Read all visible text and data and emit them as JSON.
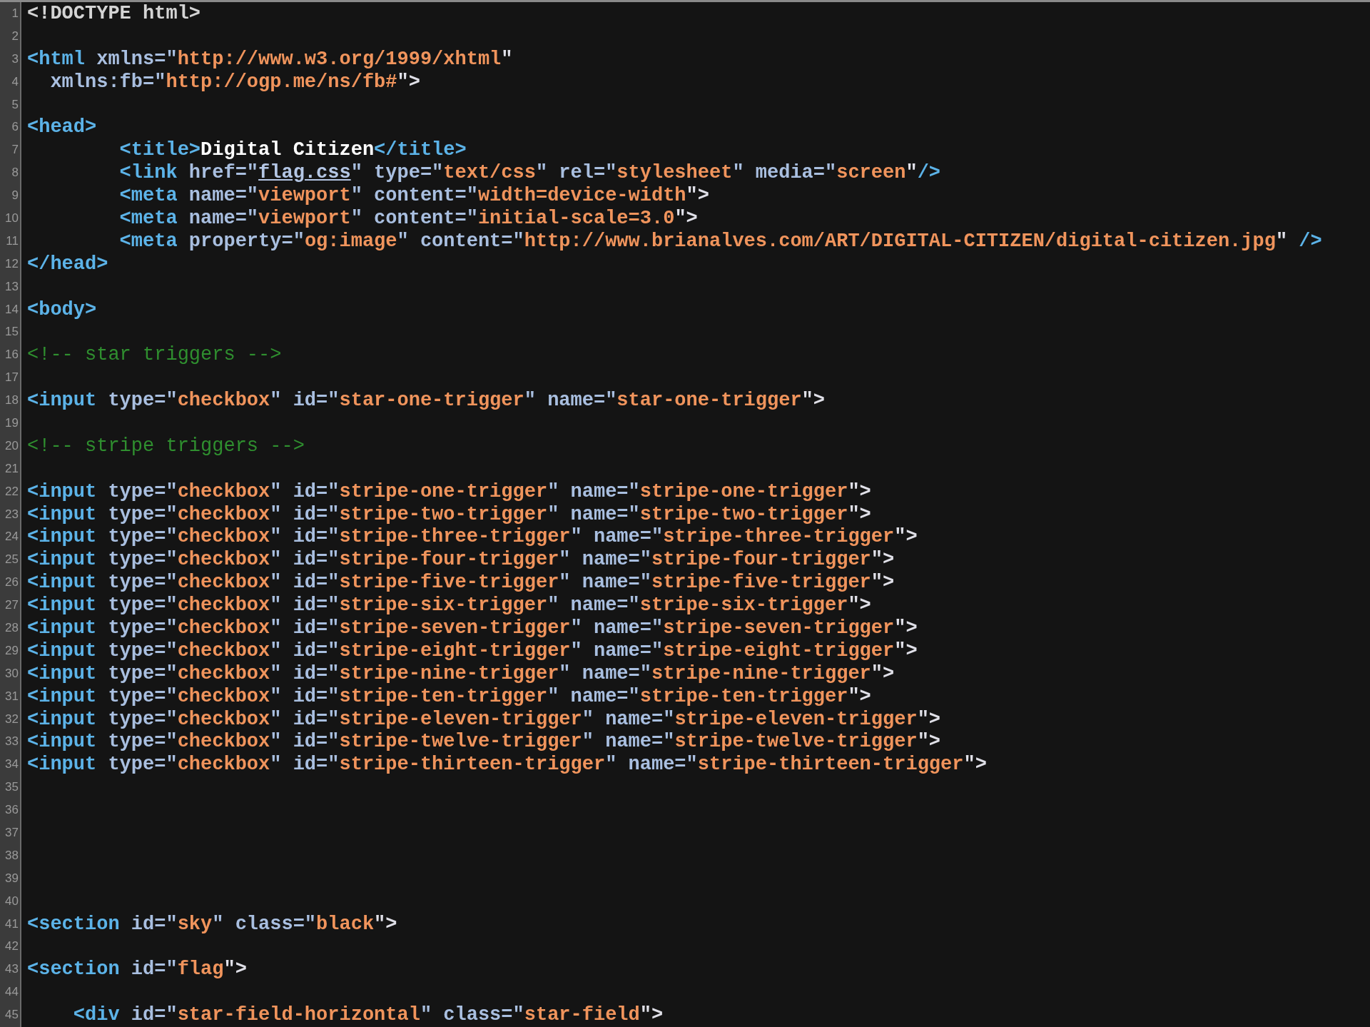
{
  "editor": {
    "lines": [
      {
        "number": "1",
        "tokens": [
          {
            "kind": "doctype",
            "text": "<!DOCTYPE html>"
          }
        ]
      },
      {
        "number": "2"
      },
      {
        "number": "3",
        "tokens": [
          {
            "kind": "tag",
            "text": "<html"
          },
          {
            "kind": "attr",
            "text": " xmlns=\""
          },
          {
            "kind": "string",
            "text": "http://www.w3.org/1999/xhtml"
          },
          {
            "kind": "punct",
            "text": "\""
          }
        ]
      },
      {
        "number": "4",
        "tokens": [
          {
            "kind": "attr",
            "text": "  xmlns:fb=\""
          },
          {
            "kind": "string",
            "text": "http://ogp.me/ns/fb#"
          },
          {
            "kind": "punct",
            "text": "\">"
          }
        ]
      },
      {
        "number": "5"
      },
      {
        "number": "6",
        "tokens": [
          {
            "kind": "tag",
            "text": "<head>"
          }
        ]
      },
      {
        "number": "7",
        "tokens": [
          {
            "kind": "tag",
            "text": "        <title>"
          },
          {
            "kind": "text",
            "text": "Digital Citizen"
          },
          {
            "kind": "tag",
            "text": "</title>"
          }
        ]
      },
      {
        "number": "8",
        "tokens": [
          {
            "kind": "tag",
            "text": "        <link"
          },
          {
            "kind": "attr",
            "text": " href=\""
          },
          {
            "kind": "link",
            "text": "flag.css"
          },
          {
            "kind": "attr",
            "text": "\" type=\""
          },
          {
            "kind": "string",
            "text": "text/css"
          },
          {
            "kind": "attr",
            "text": "\" rel=\""
          },
          {
            "kind": "string",
            "text": "stylesheet"
          },
          {
            "kind": "attr",
            "text": "\" media=\""
          },
          {
            "kind": "string",
            "text": "screen"
          },
          {
            "kind": "punct",
            "text": "\""
          },
          {
            "kind": "tag",
            "text": "/>"
          }
        ]
      },
      {
        "number": "9",
        "tokens": [
          {
            "kind": "tag",
            "text": "        <meta"
          },
          {
            "kind": "attr",
            "text": " name=\""
          },
          {
            "kind": "string",
            "text": "viewport"
          },
          {
            "kind": "attr",
            "text": "\" content=\""
          },
          {
            "kind": "string",
            "text": "width=device-width"
          },
          {
            "kind": "punct",
            "text": "\">"
          }
        ]
      },
      {
        "number": "10",
        "tokens": [
          {
            "kind": "tag",
            "text": "        <meta"
          },
          {
            "kind": "attr",
            "text": " name=\""
          },
          {
            "kind": "string",
            "text": "viewport"
          },
          {
            "kind": "attr",
            "text": "\" content=\""
          },
          {
            "kind": "string",
            "text": "initial-scale=3.0"
          },
          {
            "kind": "punct",
            "text": "\">"
          }
        ]
      },
      {
        "number": "11",
        "tokens": [
          {
            "kind": "tag",
            "text": "        <meta"
          },
          {
            "kind": "attr",
            "text": " property=\""
          },
          {
            "kind": "string",
            "text": "og:image"
          },
          {
            "kind": "attr",
            "text": "\" content=\""
          },
          {
            "kind": "string",
            "text": "http://www.brianalves.com/ART/DIGITAL-CITIZEN/digital-citizen.jpg"
          },
          {
            "kind": "punct",
            "text": "\" "
          },
          {
            "kind": "tag",
            "text": "/>"
          }
        ]
      },
      {
        "number": "12",
        "tokens": [
          {
            "kind": "tag",
            "text": "</head>"
          }
        ]
      },
      {
        "number": "13"
      },
      {
        "number": "14",
        "tokens": [
          {
            "kind": "tag",
            "text": "<body>"
          }
        ]
      },
      {
        "number": "15"
      },
      {
        "number": "16",
        "tokens": [
          {
            "kind": "comment",
            "text": "<!-- star triggers -->"
          }
        ]
      },
      {
        "number": "17"
      },
      {
        "number": "18",
        "tokens": [
          {
            "kind": "tag",
            "text": "<input"
          },
          {
            "kind": "attr",
            "text": " type=\""
          },
          {
            "kind": "string",
            "text": "checkbox"
          },
          {
            "kind": "attr",
            "text": "\" id=\""
          },
          {
            "kind": "string",
            "text": "star-one-trigger"
          },
          {
            "kind": "attr",
            "text": "\" name=\""
          },
          {
            "kind": "string",
            "text": "star-one-trigger"
          },
          {
            "kind": "punct",
            "text": "\">"
          }
        ]
      },
      {
        "number": "19"
      },
      {
        "number": "20",
        "tokens": [
          {
            "kind": "comment",
            "text": "<!-- stripe triggers -->"
          }
        ]
      },
      {
        "number": "21"
      },
      {
        "number": "22",
        "tokens": [
          {
            "kind": "tag",
            "text": "<input"
          },
          {
            "kind": "attr",
            "text": " type=\""
          },
          {
            "kind": "string",
            "text": "checkbox"
          },
          {
            "kind": "attr",
            "text": "\" id=\""
          },
          {
            "kind": "string",
            "text": "stripe-one-trigger"
          },
          {
            "kind": "attr",
            "text": "\" name=\""
          },
          {
            "kind": "string",
            "text": "stripe-one-trigger"
          },
          {
            "kind": "punct",
            "text": "\">"
          }
        ]
      },
      {
        "number": "23",
        "tokens": [
          {
            "kind": "tag",
            "text": "<input"
          },
          {
            "kind": "attr",
            "text": " type=\""
          },
          {
            "kind": "string",
            "text": "checkbox"
          },
          {
            "kind": "attr",
            "text": "\" id=\""
          },
          {
            "kind": "string",
            "text": "stripe-two-trigger"
          },
          {
            "kind": "attr",
            "text": "\" name=\""
          },
          {
            "kind": "string",
            "text": "stripe-two-trigger"
          },
          {
            "kind": "punct",
            "text": "\">"
          }
        ]
      },
      {
        "number": "24",
        "tokens": [
          {
            "kind": "tag",
            "text": "<input"
          },
          {
            "kind": "attr",
            "text": " type=\""
          },
          {
            "kind": "string",
            "text": "checkbox"
          },
          {
            "kind": "attr",
            "text": "\" id=\""
          },
          {
            "kind": "string",
            "text": "stripe-three-trigger"
          },
          {
            "kind": "attr",
            "text": "\" name=\""
          },
          {
            "kind": "string",
            "text": "stripe-three-trigger"
          },
          {
            "kind": "punct",
            "text": "\">"
          }
        ]
      },
      {
        "number": "25",
        "tokens": [
          {
            "kind": "tag",
            "text": "<input"
          },
          {
            "kind": "attr",
            "text": " type=\""
          },
          {
            "kind": "string",
            "text": "checkbox"
          },
          {
            "kind": "attr",
            "text": "\" id=\""
          },
          {
            "kind": "string",
            "text": "stripe-four-trigger"
          },
          {
            "kind": "attr",
            "text": "\" name=\""
          },
          {
            "kind": "string",
            "text": "stripe-four-trigger"
          },
          {
            "kind": "punct",
            "text": "\">"
          }
        ]
      },
      {
        "number": "26",
        "tokens": [
          {
            "kind": "tag",
            "text": "<input"
          },
          {
            "kind": "attr",
            "text": " type=\""
          },
          {
            "kind": "string",
            "text": "checkbox"
          },
          {
            "kind": "attr",
            "text": "\" id=\""
          },
          {
            "kind": "string",
            "text": "stripe-five-trigger"
          },
          {
            "kind": "attr",
            "text": "\" name=\""
          },
          {
            "kind": "string",
            "text": "stripe-five-trigger"
          },
          {
            "kind": "punct",
            "text": "\">"
          }
        ]
      },
      {
        "number": "27",
        "tokens": [
          {
            "kind": "tag",
            "text": "<input"
          },
          {
            "kind": "attr",
            "text": " type=\""
          },
          {
            "kind": "string",
            "text": "checkbox"
          },
          {
            "kind": "attr",
            "text": "\" id=\""
          },
          {
            "kind": "string",
            "text": "stripe-six-trigger"
          },
          {
            "kind": "attr",
            "text": "\" name=\""
          },
          {
            "kind": "string",
            "text": "stripe-six-trigger"
          },
          {
            "kind": "punct",
            "text": "\">"
          }
        ]
      },
      {
        "number": "28",
        "tokens": [
          {
            "kind": "tag",
            "text": "<input"
          },
          {
            "kind": "attr",
            "text": " type=\""
          },
          {
            "kind": "string",
            "text": "checkbox"
          },
          {
            "kind": "attr",
            "text": "\" id=\""
          },
          {
            "kind": "string",
            "text": "stripe-seven-trigger"
          },
          {
            "kind": "attr",
            "text": "\" name=\""
          },
          {
            "kind": "string",
            "text": "stripe-seven-trigger"
          },
          {
            "kind": "punct",
            "text": "\">"
          }
        ]
      },
      {
        "number": "29",
        "tokens": [
          {
            "kind": "tag",
            "text": "<input"
          },
          {
            "kind": "attr",
            "text": " type=\""
          },
          {
            "kind": "string",
            "text": "checkbox"
          },
          {
            "kind": "attr",
            "text": "\" id=\""
          },
          {
            "kind": "string",
            "text": "stripe-eight-trigger"
          },
          {
            "kind": "attr",
            "text": "\" name=\""
          },
          {
            "kind": "string",
            "text": "stripe-eight-trigger"
          },
          {
            "kind": "punct",
            "text": "\">"
          }
        ]
      },
      {
        "number": "30",
        "tokens": [
          {
            "kind": "tag",
            "text": "<input"
          },
          {
            "kind": "attr",
            "text": " type=\""
          },
          {
            "kind": "string",
            "text": "checkbox"
          },
          {
            "kind": "attr",
            "text": "\" id=\""
          },
          {
            "kind": "string",
            "text": "stripe-nine-trigger"
          },
          {
            "kind": "attr",
            "text": "\" name=\""
          },
          {
            "kind": "string",
            "text": "stripe-nine-trigger"
          },
          {
            "kind": "punct",
            "text": "\">"
          }
        ]
      },
      {
        "number": "31",
        "tokens": [
          {
            "kind": "tag",
            "text": "<input"
          },
          {
            "kind": "attr",
            "text": " type=\""
          },
          {
            "kind": "string",
            "text": "checkbox"
          },
          {
            "kind": "attr",
            "text": "\" id=\""
          },
          {
            "kind": "string",
            "text": "stripe-ten-trigger"
          },
          {
            "kind": "attr",
            "text": "\" name=\""
          },
          {
            "kind": "string",
            "text": "stripe-ten-trigger"
          },
          {
            "kind": "punct",
            "text": "\">"
          }
        ]
      },
      {
        "number": "32",
        "tokens": [
          {
            "kind": "tag",
            "text": "<input"
          },
          {
            "kind": "attr",
            "text": " type=\""
          },
          {
            "kind": "string",
            "text": "checkbox"
          },
          {
            "kind": "attr",
            "text": "\" id=\""
          },
          {
            "kind": "string",
            "text": "stripe-eleven-trigger"
          },
          {
            "kind": "attr",
            "text": "\" name=\""
          },
          {
            "kind": "string",
            "text": "stripe-eleven-trigger"
          },
          {
            "kind": "punct",
            "text": "\">"
          }
        ]
      },
      {
        "number": "33",
        "tokens": [
          {
            "kind": "tag",
            "text": "<input"
          },
          {
            "kind": "attr",
            "text": " type=\""
          },
          {
            "kind": "string",
            "text": "checkbox"
          },
          {
            "kind": "attr",
            "text": "\" id=\""
          },
          {
            "kind": "string",
            "text": "stripe-twelve-trigger"
          },
          {
            "kind": "attr",
            "text": "\" name=\""
          },
          {
            "kind": "string",
            "text": "stripe-twelve-trigger"
          },
          {
            "kind": "punct",
            "text": "\">"
          }
        ]
      },
      {
        "number": "34",
        "tokens": [
          {
            "kind": "tag",
            "text": "<input"
          },
          {
            "kind": "attr",
            "text": " type=\""
          },
          {
            "kind": "string",
            "text": "checkbox"
          },
          {
            "kind": "attr",
            "text": "\" id=\""
          },
          {
            "kind": "string",
            "text": "stripe-thirteen-trigger"
          },
          {
            "kind": "attr",
            "text": "\" name=\""
          },
          {
            "kind": "string",
            "text": "stripe-thirteen-trigger"
          },
          {
            "kind": "punct",
            "text": "\">"
          }
        ]
      },
      {
        "number": "35"
      },
      {
        "number": "36"
      },
      {
        "number": "37"
      },
      {
        "number": "38"
      },
      {
        "number": "39"
      },
      {
        "number": "40"
      },
      {
        "number": "41",
        "tokens": [
          {
            "kind": "tag",
            "text": "<section"
          },
          {
            "kind": "attr",
            "text": " id=\""
          },
          {
            "kind": "string",
            "text": "sky"
          },
          {
            "kind": "attr",
            "text": "\" class=\""
          },
          {
            "kind": "string",
            "text": "black"
          },
          {
            "kind": "punct",
            "text": "\">"
          }
        ]
      },
      {
        "number": "42"
      },
      {
        "number": "43",
        "tokens": [
          {
            "kind": "tag",
            "text": "<section"
          },
          {
            "kind": "attr",
            "text": " id=\""
          },
          {
            "kind": "string",
            "text": "flag"
          },
          {
            "kind": "punct",
            "text": "\">"
          }
        ]
      },
      {
        "number": "44"
      },
      {
        "number": "45",
        "tokens": [
          {
            "kind": "tag",
            "text": "    <div"
          },
          {
            "kind": "attr",
            "text": " id=\""
          },
          {
            "kind": "string",
            "text": "star-field-horizontal"
          },
          {
            "kind": "attr",
            "text": "\" class=\""
          },
          {
            "kind": "string",
            "text": "star-field"
          },
          {
            "kind": "punct",
            "text": "\">"
          }
        ]
      }
    ]
  }
}
